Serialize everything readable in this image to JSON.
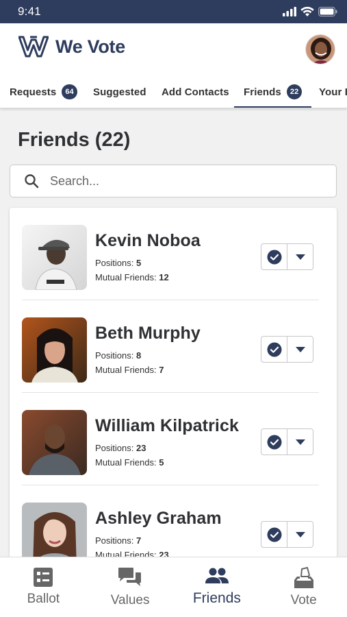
{
  "status_bar": {
    "time": "9:41"
  },
  "header": {
    "app_name": "We Vote"
  },
  "tabs": [
    {
      "label": "Requests",
      "badge": "64"
    },
    {
      "label": "Suggested",
      "badge": ""
    },
    {
      "label": "Add Contacts",
      "badge": ""
    },
    {
      "label": "Friends",
      "badge": "22",
      "active": true
    },
    {
      "label": "Your I",
      "badge": ""
    }
  ],
  "page": {
    "title": "Friends (22)"
  },
  "search": {
    "placeholder": "Search..."
  },
  "labels": {
    "positions": "Positions:",
    "mutual": "Mutual Friends:"
  },
  "friends": [
    {
      "name": "Kevin Noboa",
      "positions": "5",
      "mutual": "12"
    },
    {
      "name": "Beth Murphy",
      "positions": "8",
      "mutual": "7"
    },
    {
      "name": "William Kilpatrick",
      "positions": "23",
      "mutual": "5"
    },
    {
      "name": "Ashley Graham",
      "positions": "7",
      "mutual": "23"
    }
  ],
  "bottom_nav": [
    {
      "label": "Ballot",
      "icon": "ballot-icon"
    },
    {
      "label": "Values",
      "icon": "chat-icon"
    },
    {
      "label": "Friends",
      "icon": "people-icon",
      "active": true
    },
    {
      "label": "Vote",
      "icon": "vote-box-icon"
    }
  ],
  "colors": {
    "brand": "#2e3c5d",
    "background": "#f1f1f1"
  }
}
